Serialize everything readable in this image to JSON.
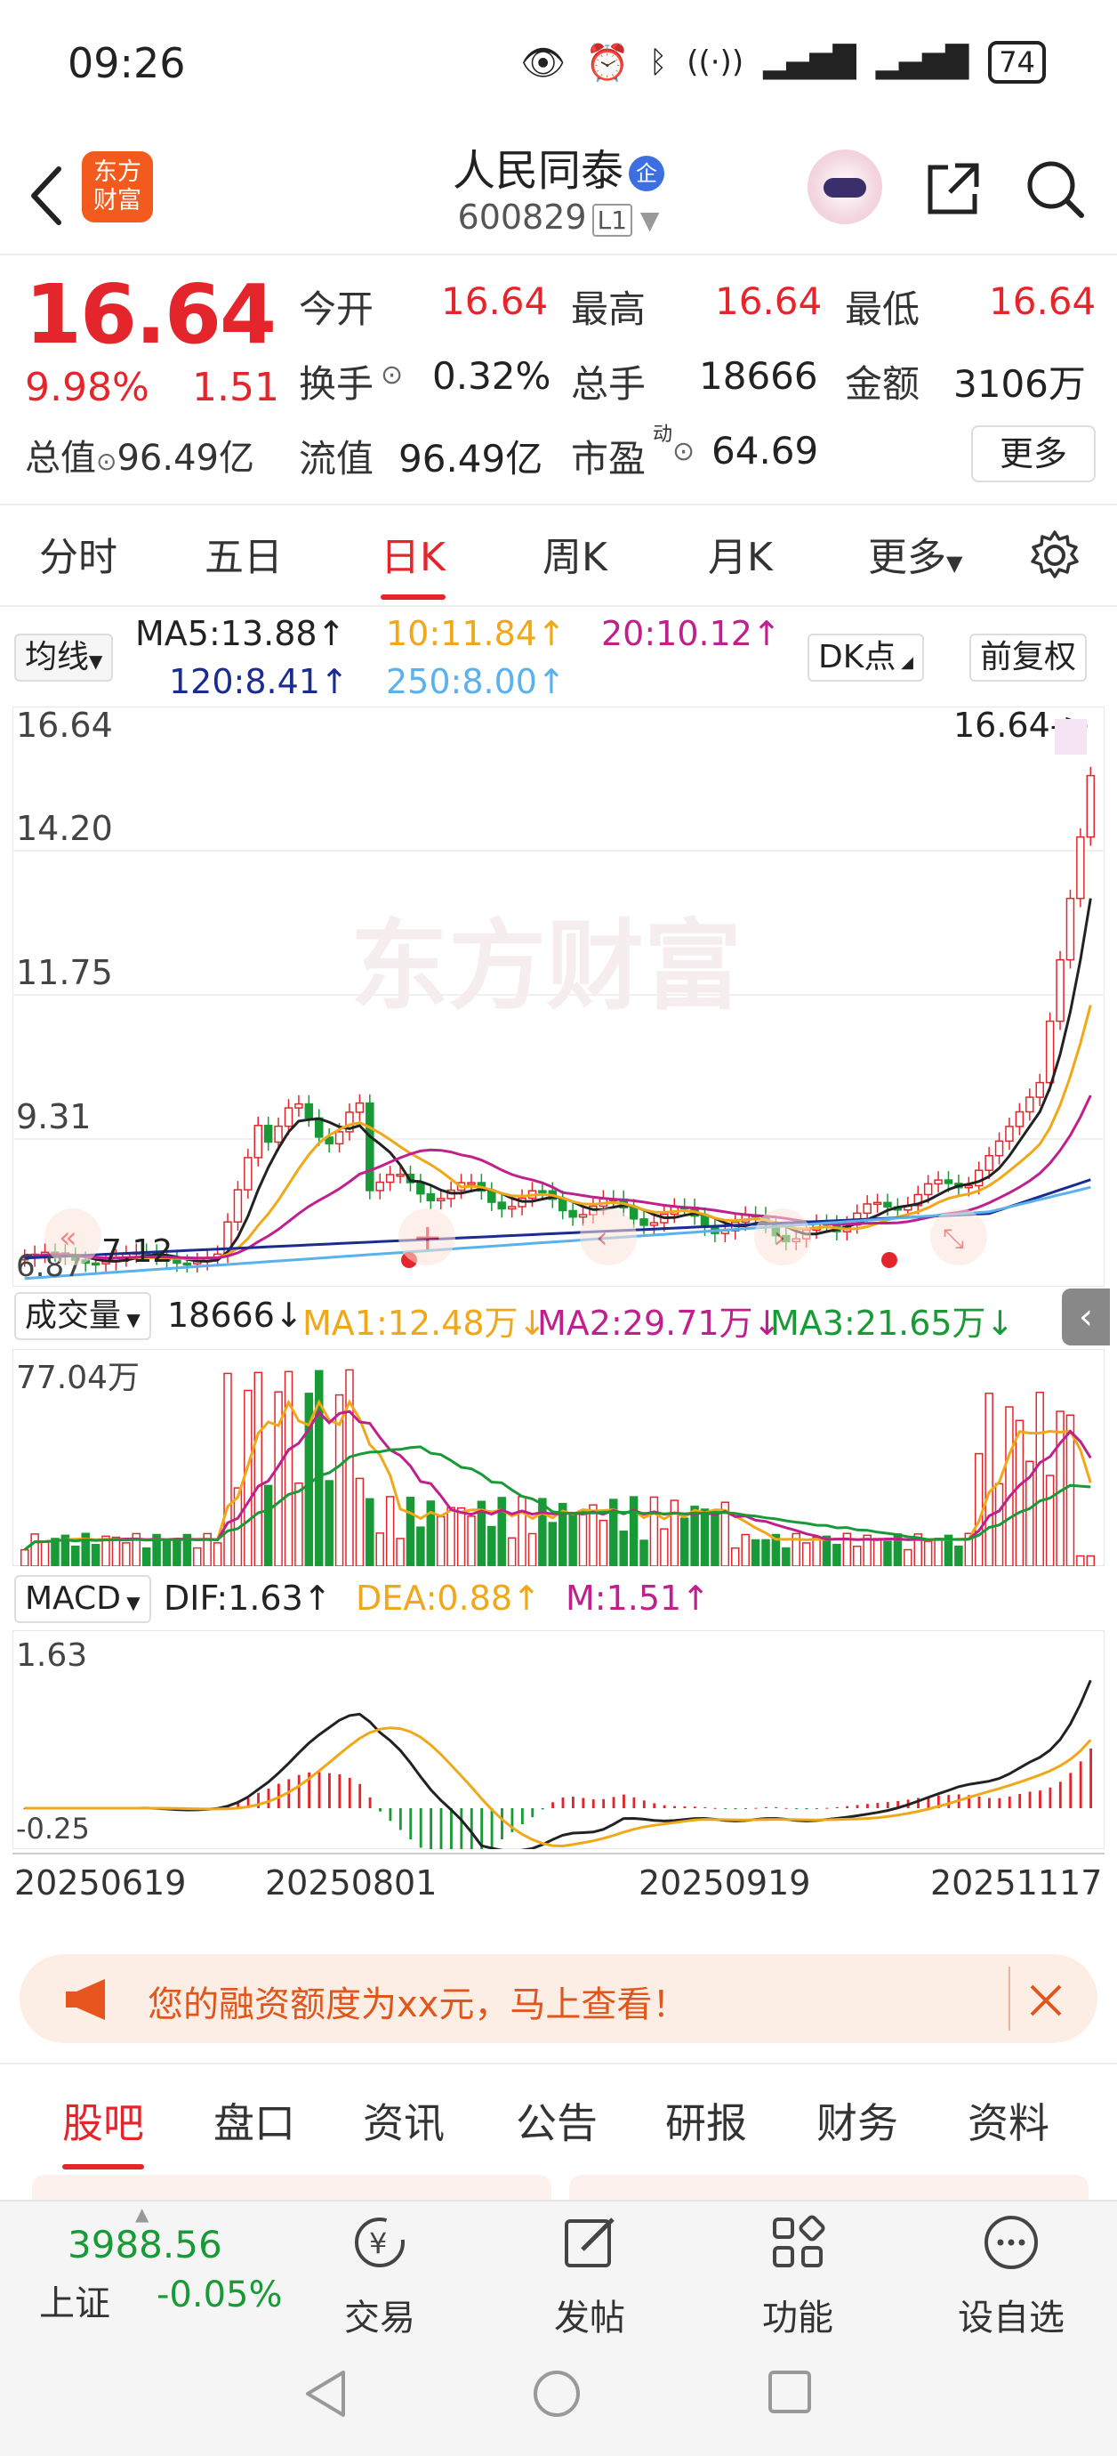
{
  "status_bar": {
    "time": "09:26",
    "battery": "74"
  },
  "header": {
    "logo_line1": "东方",
    "logo_line2": "财富",
    "stock_name": "人民同泰",
    "enterprise_badge": "企",
    "stock_code": "600829",
    "level": "L1"
  },
  "quote": {
    "price": "16.64",
    "change_pct": "9.98%",
    "change": "1.51",
    "open_label": "今开",
    "open": "16.64",
    "high_label": "最高",
    "high": "16.64",
    "low_label": "最低",
    "low": "16.64",
    "turnover_label": "换手",
    "turnover": "0.32%",
    "volume_label": "总手",
    "volume": "18666",
    "amount_label": "金额",
    "amount": "3106万",
    "total_value_label": "总值",
    "total_value": "96.49亿",
    "float_value_label": "流值",
    "float_value": "96.49亿",
    "pe_label": "市盈",
    "pe_sup": "动",
    "pe": "64.69",
    "more_button": "更多"
  },
  "period_tabs": [
    "分时",
    "五日",
    "日K",
    "周K",
    "月K",
    "更多"
  ],
  "period_active": 2,
  "ma_row": {
    "selector": "均线",
    "ma5": "MA5:13.88↑",
    "ma10": "10:11.84↑",
    "ma20": "20:10.12↑",
    "ma120": "120:8.41↑",
    "ma250": "250:8.00↑",
    "dk_button": "DK点",
    "adjust_button": "前复权"
  },
  "colors": {
    "up": "#e4262c",
    "down": "#189a36",
    "ma5": "#222222",
    "ma10": "#f0a818",
    "ma20": "#c0208c",
    "ma120": "#1a2c8f",
    "ma250": "#5ab2ec"
  },
  "kline": {
    "y_labels": [
      "16.64",
      "14.20",
      "11.75",
      "9.31",
      "6.87"
    ],
    "last_price_tag": "16.64->",
    "low_marker": "7.12",
    "watermark": "东方财富"
  },
  "volume_row": {
    "selector": "成交量",
    "value": "18666↓",
    "ma1": "MA1:12.48万↓",
    "ma2": "MA2:29.71万↓",
    "ma3": "MA3:21.65万↓",
    "y_max_label": "77.04万"
  },
  "macd_row": {
    "selector": "MACD",
    "dif": "DIF:1.63↑",
    "dea": "DEA:0.88↑",
    "m": "M:1.51↑",
    "y_top_label": "1.63",
    "y_bottom_label": "-0.25"
  },
  "dates": [
    "20250619",
    "20250801",
    "20250919",
    "20251117"
  ],
  "banner": {
    "text": "您的融资额度为xx元，马上查看！"
  },
  "content_tabs": [
    "股吧",
    "盘口",
    "资讯",
    "公告",
    "研报",
    "财务",
    "资料"
  ],
  "content_active": 0,
  "bottom_nav": {
    "index_name": "上证",
    "index_value": "3988.56",
    "index_change": "-0.05%",
    "trade": "交易",
    "post": "发帖",
    "functions": "功能",
    "watchlist": "设自选"
  }
}
